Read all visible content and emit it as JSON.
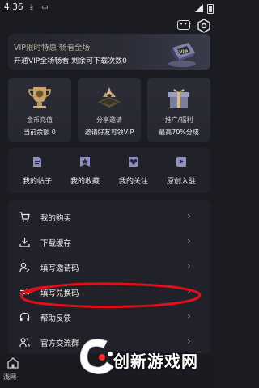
{
  "status_bar": {
    "time": "4:36"
  },
  "vip_banner": {
    "title": "VIP限时特惠  畅看全场",
    "subtitle": "开通VIP全场畅看  剩余可下载次数0"
  },
  "cards": [
    {
      "title": "金币充值",
      "subtitle": "当前余额 0"
    },
    {
      "title": "分享邀请",
      "subtitle": "邀请好友可领VIP"
    },
    {
      "title": "推广/福利",
      "subtitle": "最高70%分成"
    }
  ],
  "quick_links": [
    "我的帖子",
    "我的收藏",
    "我的关注",
    "原创入驻"
  ],
  "menu": [
    {
      "label": "我的购买",
      "icon": "cart-icon"
    },
    {
      "label": "下载缓存",
      "icon": "download-icon"
    },
    {
      "label": "填写邀请码",
      "icon": "invite-user-icon"
    },
    {
      "label": "填写兑换码",
      "icon": "exchange-icon"
    },
    {
      "label": "帮助反馈",
      "icon": "headset-icon"
    },
    {
      "label": "官方交流群",
      "icon": "group-icon"
    }
  ],
  "chevron": "›",
  "bottom_nav": {
    "home_label": "浅网"
  },
  "watermark": {
    "text": "创新游戏网"
  },
  "colors": {
    "background": "#1b1c22",
    "panel": "#202129",
    "annotation": "#e0101b",
    "gold": "#c8a46a"
  }
}
